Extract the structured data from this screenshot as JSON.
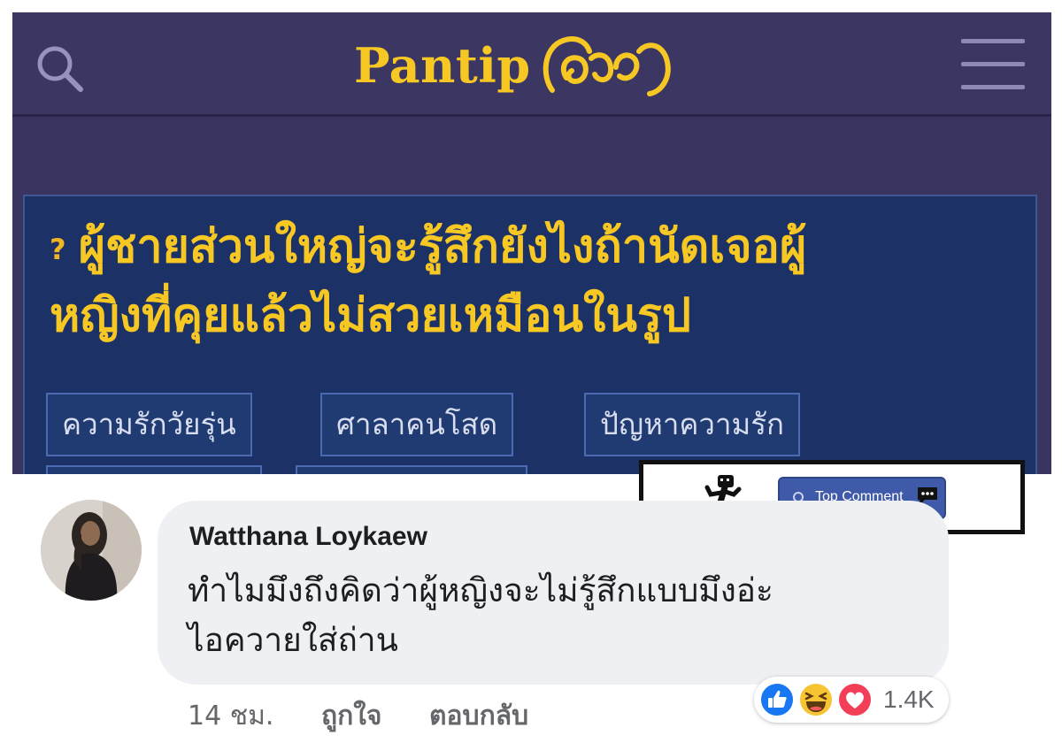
{
  "pantip": {
    "logo_text": "Pantip",
    "title_icon": "question-mark-icon",
    "title_line1": "ผู้ชายส่วนใหญ่จะรู้สึกยังไงถ้านัดเจอผู้",
    "title_line2": "หญิงที่คุยแล้วไม่สวยเหมือนในรูป",
    "tags": [
      "ความรักวัยรุ่น",
      "ศาลาคนโสด",
      "ปัญหาความรัก"
    ],
    "colors": {
      "header_bg": "#3c3762",
      "card_bg": "#1c3165",
      "accent_yellow": "#f7c824"
    }
  },
  "badge": {
    "icon": "running-figure-icon",
    "label": "Top Comment"
  },
  "comment": {
    "author": "Watthana Loykaew",
    "text_line1": "ทำไมมึงถึงคิดว่าผู้หญิงจะไม่รู้สึกแบบมึงอ่ะ",
    "text_line2": "ไอควายใส่ถ่าน",
    "time": "14 ชม.",
    "like_label": "ถูกใจ",
    "reply_label": "ตอบกลับ",
    "reactions": [
      "like-icon",
      "haha-icon",
      "love-icon"
    ],
    "reaction_count": "1.4K"
  }
}
